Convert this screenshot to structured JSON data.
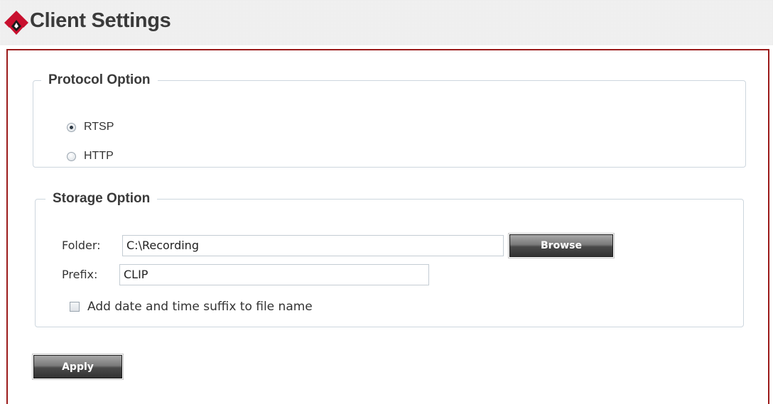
{
  "header": {
    "title": "Client Settings",
    "logo_icon": "client-settings-logo-icon",
    "logo_colors": {
      "outer": "#c8102e",
      "inner": "#1a1a1a"
    }
  },
  "protocol": {
    "legend": "Protocol Option",
    "options": [
      {
        "label": "RTSP",
        "checked": true
      },
      {
        "label": "HTTP",
        "checked": false
      }
    ]
  },
  "storage": {
    "legend": "Storage Option",
    "folder_label": "Folder:",
    "folder_value": "C:\\Recording",
    "browse_label": "Browse",
    "prefix_label": "Prefix:",
    "prefix_value": "CLIP",
    "suffix_label": "Add date and time suffix to file name",
    "suffix_checked": false
  },
  "apply_label": "Apply",
  "colors": {
    "panel_border": "#9b1b1b",
    "fieldset_border": "#cdd6de",
    "button_dark": "#333333"
  }
}
